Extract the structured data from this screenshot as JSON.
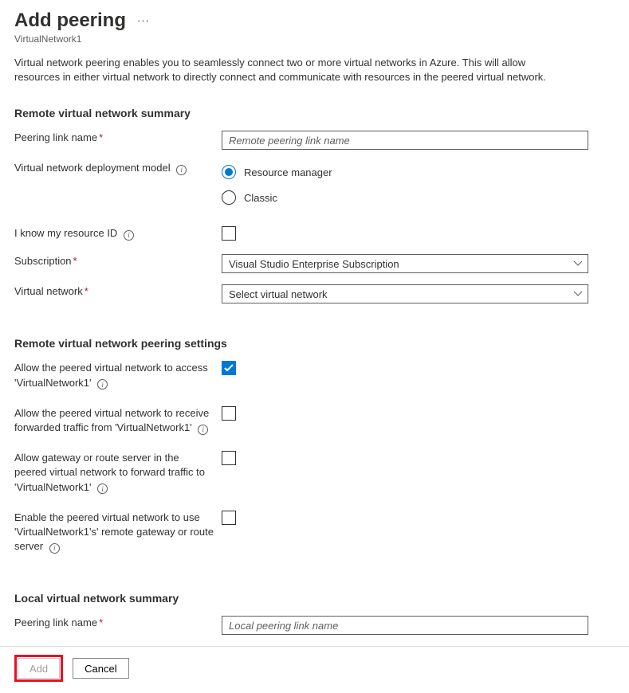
{
  "header": {
    "title": "Add peering",
    "resource": "VirtualNetwork1",
    "intro": "Virtual network peering enables you to seamlessly connect two or more virtual networks in Azure. This will allow resources in either virtual network to directly connect and communicate with resources in the peered virtual network."
  },
  "remote_summary": {
    "heading": "Remote virtual network summary",
    "link_name_label": "Peering link name",
    "link_name_placeholder": "Remote peering link name",
    "deploy_model_label": "Virtual network deployment model",
    "radio_rm": "Resource manager",
    "radio_classic": "Classic",
    "know_id_label": "I know my resource ID",
    "subscription_label": "Subscription",
    "subscription_value": "Visual Studio Enterprise Subscription",
    "vnet_label": "Virtual network",
    "vnet_value": "Select virtual network"
  },
  "remote_settings": {
    "heading": "Remote virtual network peering settings",
    "opt1": "Allow the peered virtual network to access 'VirtualNetwork1'",
    "opt2": "Allow the peered virtual network to receive forwarded traffic from 'VirtualNetwork1'",
    "opt3": "Allow gateway or route server in the peered virtual network to forward traffic to 'VirtualNetwork1'",
    "opt4": "Enable the peered virtual network to use 'VirtualNetwork1's' remote gateway or route server"
  },
  "local_summary": {
    "heading": "Local virtual network summary",
    "link_name_label": "Peering link name",
    "link_name_placeholder": "Local peering link name"
  },
  "footer": {
    "add": "Add",
    "cancel": "Cancel"
  }
}
